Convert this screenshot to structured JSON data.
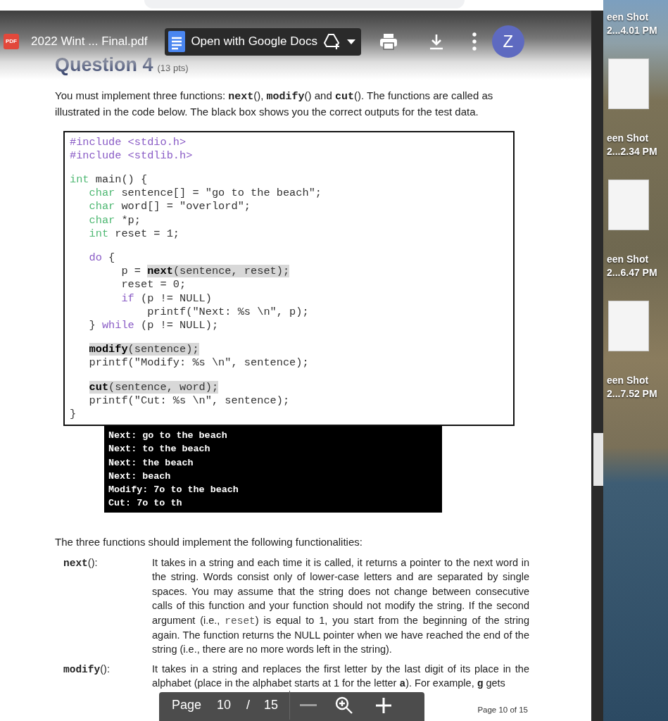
{
  "browser": {
    "toolbar": {
      "pdf_badge": "PDF",
      "file_name": "2022 Wint ... Final.pdf",
      "open_with_button": "Open with Google Docs",
      "avatar_initial": "Z"
    },
    "document": {
      "heading": "Question 4",
      "points": "(13 pts)",
      "intro": [
        {
          "kind": "text",
          "t": "You must implement three functions: "
        },
        {
          "kind": "code-bold",
          "t": "next"
        },
        {
          "kind": "text",
          "t": "(), "
        },
        {
          "kind": "code-bold",
          "t": "modify"
        },
        {
          "kind": "text",
          "t": "() and "
        },
        {
          "kind": "code-bold",
          "t": "cut"
        },
        {
          "kind": "text",
          "t": "(). The functions are called as illustrated in the code below. The black box shows you the correct outputs for the test data."
        }
      ],
      "code_blocks": [
        [
          {
            "indented": false,
            "segments": [
              {
                "kind": "directive",
                "t": "#include <stdio.h>"
              }
            ]
          },
          {
            "indented": false,
            "segments": [
              {
                "kind": "directive",
                "t": "#include <stdlib.h>"
              }
            ]
          }
        ],
        [
          {
            "indented": false,
            "segments": [
              {
                "kind": "type",
                "t": "int"
              },
              {
                "kind": "plain",
                "t": " main() {"
              }
            ]
          },
          {
            "indented": true,
            "segments": [
              {
                "kind": "type",
                "t": "char"
              },
              {
                "kind": "plain",
                "t": " sentence[] = \"go to the beach\";"
              }
            ]
          },
          {
            "indented": true,
            "segments": [
              {
                "kind": "type",
                "t": "char"
              },
              {
                "kind": "plain",
                "t": " word[] = \"overlord\";"
              }
            ]
          },
          {
            "indented": true,
            "segments": [
              {
                "kind": "type",
                "t": "char"
              },
              {
                "kind": "plain",
                "t": " *p;"
              }
            ]
          },
          {
            "indented": true,
            "segments": [
              {
                "kind": "type",
                "t": "int"
              },
              {
                "kind": "plain",
                "t": " reset = 1;"
              }
            ]
          }
        ],
        [
          {
            "indented": true,
            "segments": [
              {
                "kind": "keyword",
                "t": "do"
              },
              {
                "kind": "plain",
                "t": " {"
              }
            ]
          },
          {
            "indented": true,
            "segments": [
              {
                "kind": "plain",
                "t": "     p = "
              },
              {
                "kind": "call",
                "t": "next"
              },
              {
                "kind": "hl",
                "t": "(sentence, reset);"
              }
            ]
          },
          {
            "indented": true,
            "segments": [
              {
                "kind": "plain",
                "t": "     reset = 0;"
              }
            ]
          },
          {
            "indented": true,
            "segments": [
              {
                "kind": "keyword",
                "t": "     if"
              },
              {
                "kind": "plain",
                "t": " (p != NULL)"
              }
            ]
          },
          {
            "indented": true,
            "segments": [
              {
                "kind": "plain",
                "t": "         printf(\"Next: %s \\n\", p);"
              }
            ]
          },
          {
            "indented": true,
            "segments": [
              {
                "kind": "plain",
                "t": "} "
              },
              {
                "kind": "keyword",
                "t": "while"
              },
              {
                "kind": "plain",
                "t": " (p != NULL);"
              }
            ]
          }
        ],
        [
          {
            "indented": true,
            "segments": [
              {
                "kind": "call",
                "t": "modify"
              },
              {
                "kind": "hl",
                "t": "(sentence);"
              }
            ]
          },
          {
            "indented": true,
            "segments": [
              {
                "kind": "plain",
                "t": "printf(\"Modify: %s \\n\", sentence);"
              }
            ]
          }
        ],
        [
          {
            "indented": true,
            "segments": [
              {
                "kind": "call",
                "t": "cut"
              },
              {
                "kind": "hl",
                "t": "(sentence, word);"
              }
            ]
          },
          {
            "indented": true,
            "segments": [
              {
                "kind": "plain",
                "t": "printf(\"Cut: %s \\n\", sentence);"
              }
            ]
          },
          {
            "indented": false,
            "segments": [
              {
                "kind": "plain",
                "t": "}"
              }
            ]
          }
        ]
      ],
      "output_lines": [
        "Next: go to the beach",
        "Next: to the beach",
        "Next: the beach",
        "Next: beach",
        "Modify: 7o to the beach",
        "Cut: 7o to th"
      ],
      "functions_intro": "The three functions should implement the following functionalities:",
      "functions": [
        {
          "name": "next",
          "suffix": "():",
          "body": [
            {
              "kind": "text",
              "t": "It takes in a string and each time it is called, it returns a pointer to the next word in the string. Words consist only of lower-case letters and are separated by single spaces. You may assume that the string does not change between consecutive calls of this function and your function should not modify the string. If the second argument (i.e., "
            },
            {
              "kind": "code",
              "t": "reset"
            },
            {
              "kind": "text",
              "t": ") is equal to 1, you start from the beginning of the string again. The function returns the NULL pointer when we have reached the end of the string (i.e., there are no more words left in the string)."
            }
          ]
        },
        {
          "name": "modify",
          "suffix": "():",
          "body": [
            {
              "kind": "text",
              "t": "It takes in a string and replaces the first letter by the last digit of its place in the alphabet (place in the alphabet starts at 1 for the letter "
            },
            {
              "kind": "code-bold",
              "t": "a"
            },
            {
              "kind": "text",
              "t": "). For example, "
            },
            {
              "kind": "code-bold",
              "t": "g"
            },
            {
              "kind": "text",
              "t": " gets"
            }
          ]
        }
      ],
      "page_footer": "Page 10 of 15"
    },
    "pager": {
      "label": "Page",
      "current": "10",
      "separator": "/",
      "total": "15",
      "zoom_out": {
        "disabled": true
      }
    }
  },
  "desktop": {
    "icons": [
      {
        "label_lines": [
          "een Shot",
          "2...4.01 PM"
        ],
        "thumbnail": true
      },
      {
        "label_lines": [
          "een Shot",
          "2...2.34 PM"
        ],
        "thumbnail": true
      },
      {
        "label_lines": [
          "een Shot",
          "2...6.47 PM"
        ],
        "thumbnail": true
      },
      {
        "label_lines": [
          "een Shot",
          "2...7.52 PM"
        ],
        "thumbnail": false
      }
    ]
  }
}
